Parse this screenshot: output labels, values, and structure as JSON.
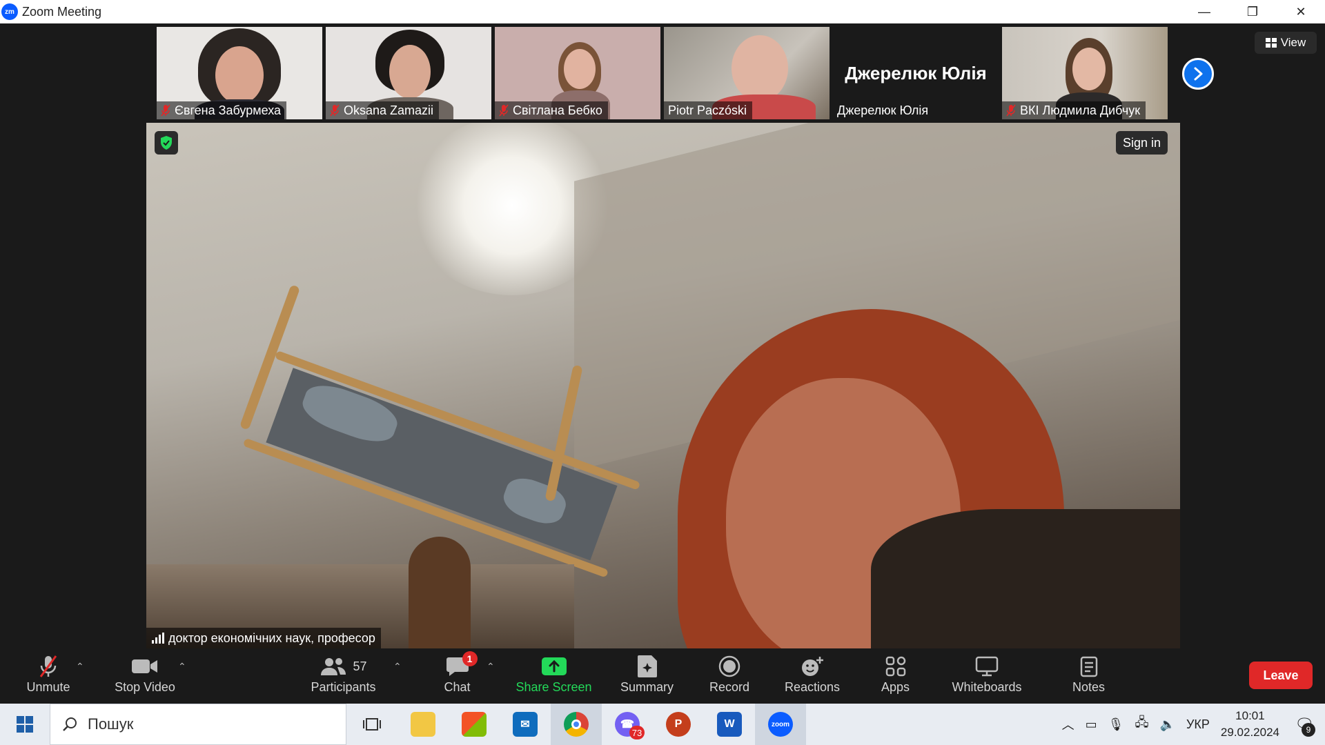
{
  "window": {
    "title": "Zoom Meeting",
    "logo_text": "zm",
    "minimize": "—",
    "restore": "❐",
    "close": "✕"
  },
  "gallery": {
    "tiles": [
      {
        "name": "Євгена Забурмеха",
        "muted": true
      },
      {
        "name": "Oksana Zamazii",
        "muted": true
      },
      {
        "name": "Світлана Бебко",
        "muted": true
      },
      {
        "name": "Piotr Paczóski",
        "muted": false
      },
      {
        "name": "Джерелюк Юлія",
        "big_name": "Джерелюк Юлія",
        "muted": false
      },
      {
        "name": "ВКІ Людмила Дибчук",
        "muted": true
      }
    ],
    "next_icon": "chevron-right-icon",
    "view_label": "View"
  },
  "main_video": {
    "speaker_name": "доктор економічних наук, професор",
    "sign_in": "Sign in"
  },
  "toolbar": {
    "unmute": "Unmute",
    "stop_video": "Stop Video",
    "participants": "Participants",
    "participants_count": "57",
    "chat": "Chat",
    "chat_badge": "1",
    "share_screen": "Share Screen",
    "summary": "Summary",
    "record": "Record",
    "reactions": "Reactions",
    "apps": "Apps",
    "whiteboards": "Whiteboards",
    "notes": "Notes",
    "leave": "Leave",
    "share_color": "#23d959",
    "leave_color": "#e02828"
  },
  "taskbar": {
    "search_placeholder": "Пошук",
    "viber_badge": "73",
    "language": "УКР",
    "time": "10:01",
    "date": "29.02.2024",
    "notifications": "9"
  }
}
